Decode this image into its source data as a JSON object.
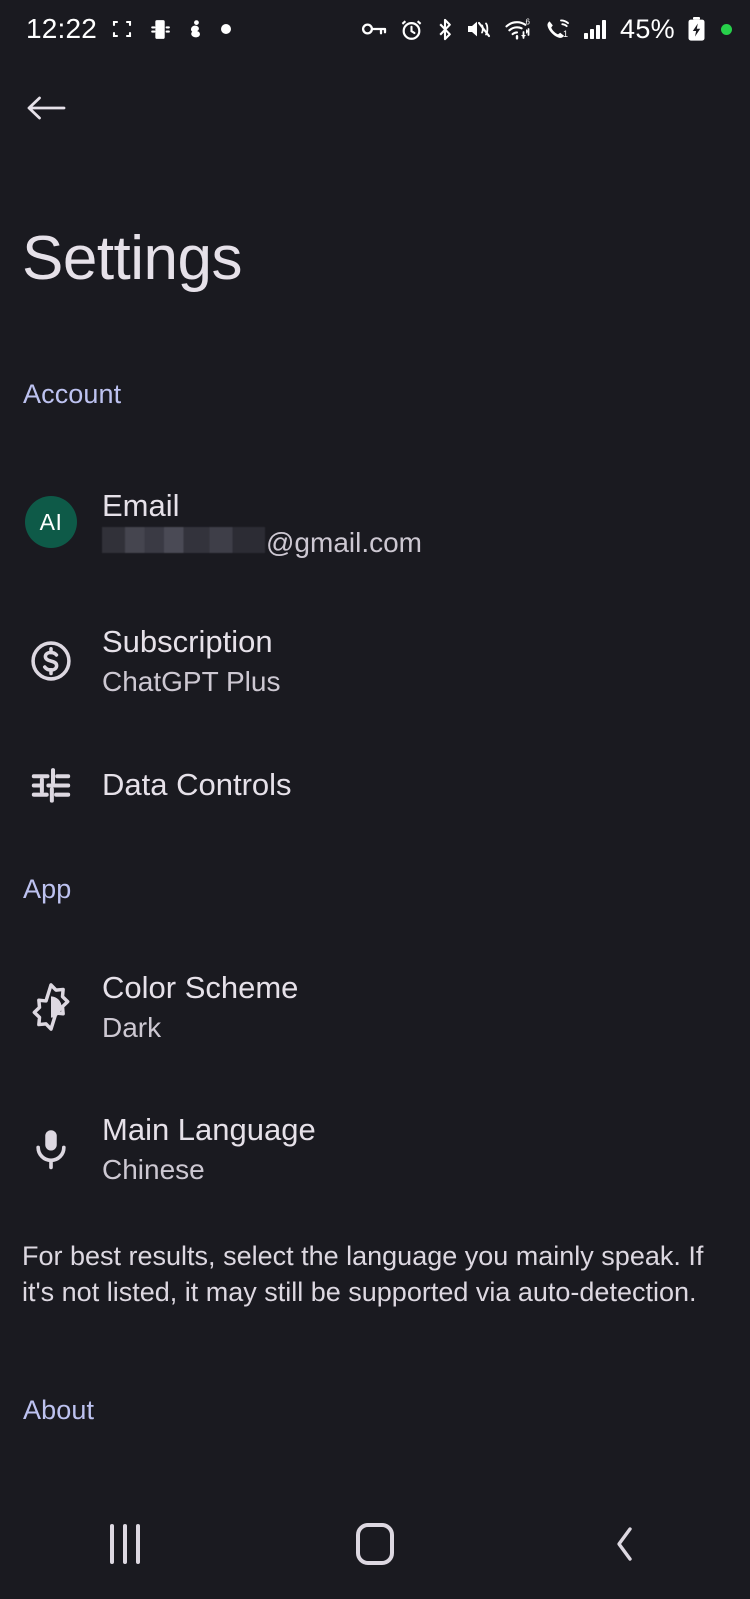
{
  "status_bar": {
    "time": "12:22",
    "battery_percent": "45%",
    "left_icons": [
      "screenshot-frame-icon",
      "device-cast-icon",
      "do-not-disturb-person-icon",
      "dot-indicator-icon"
    ],
    "right_icons": [
      "vpn-key-icon",
      "alarm-icon",
      "bluetooth-icon",
      "volume-mute-vibrate-icon",
      "wifi-icon",
      "call-active-icon",
      "cellular-signal-icon"
    ],
    "battery_state_icon": "battery-charging-icon",
    "recording_dot_icon": "green-dot-icon",
    "accent_green": "#27d04a"
  },
  "header": {
    "back_label": "Back",
    "title": "Settings"
  },
  "colors": {
    "background": "#1a1a20",
    "section_accent": "#bdc2f0",
    "primary_text": "#e6e1e9",
    "secondary_text": "#cdc8d2",
    "avatar_green": "#0e5a48"
  },
  "sections": {
    "account": {
      "label": "Account",
      "rows": [
        {
          "id": "email",
          "icon": "account-avatar",
          "avatar_initials": "AI",
          "title": "Email",
          "value_redacted": true,
          "value_suffix": "@gmail.com"
        },
        {
          "id": "subscription",
          "icon": "dollar-circle-icon",
          "title": "Subscription",
          "value": "ChatGPT Plus"
        },
        {
          "id": "data-controls",
          "icon": "sliders-tune-icon",
          "title": "Data Controls",
          "value": ""
        }
      ]
    },
    "app": {
      "label": "App",
      "rows": [
        {
          "id": "color-scheme",
          "icon": "brightness-medium-icon",
          "title": "Color Scheme",
          "value": "Dark"
        },
        {
          "id": "main-language",
          "icon": "microphone-icon",
          "title": "Main Language",
          "value": "Chinese"
        }
      ],
      "helper_text": "For best results, select the language you mainly speak. If it's not listed, it may still be supported via auto-detection."
    },
    "about": {
      "label": "About"
    }
  },
  "navigation_bar": {
    "recents_label": "Recents",
    "home_label": "Home",
    "back_label": "Back"
  }
}
